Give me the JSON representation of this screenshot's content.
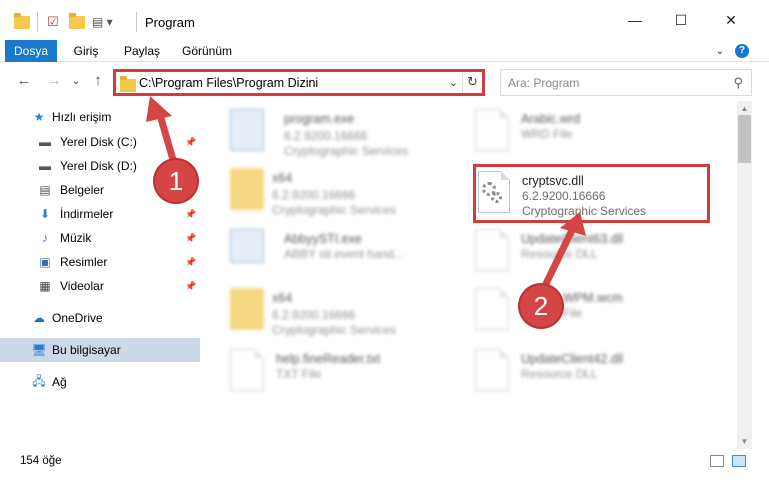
{
  "window": {
    "title": "Program",
    "minimize": "—",
    "maximize": "☐",
    "close": "✕"
  },
  "ribbon": {
    "tabs": [
      "Dosya",
      "Giriş",
      "Paylaş",
      "Görünüm"
    ],
    "help": "?"
  },
  "nav": {
    "back": "←",
    "forward": "→",
    "recent": "⌄",
    "up": "↑",
    "address": "C:\\Program Files\\Program Dizini",
    "search_placeholder": "Ara: Program"
  },
  "sidebar": {
    "items": [
      {
        "label": "Hızlı erişim",
        "icon": "star-icon"
      },
      {
        "label": "Yerel Disk (C:)",
        "icon": "drive-icon"
      },
      {
        "label": "Yerel Disk (D:)",
        "icon": "drive-icon"
      },
      {
        "label": "Belgeler",
        "icon": "documents-icon"
      },
      {
        "label": "İndirmeler",
        "icon": "download-icon"
      },
      {
        "label": "Müzik",
        "icon": "music-icon"
      },
      {
        "label": "Resimler",
        "icon": "pictures-icon"
      },
      {
        "label": "Videolar",
        "icon": "video-icon"
      },
      {
        "label": "OneDrive",
        "icon": "cloud-icon"
      },
      {
        "label": "Bu bilgisayar",
        "icon": "computer-icon"
      },
      {
        "label": "Ağ",
        "icon": "network-icon"
      }
    ]
  },
  "files": [
    {
      "name": "program.exe",
      "line1": "6.2.9200.16666",
      "line2": "Cryptographic Services",
      "icon": "exe"
    },
    {
      "name": "Arabic.wrd",
      "line1": "WRD File",
      "line2": "",
      "icon": "page"
    },
    {
      "name": "x64",
      "line1": "6.2.9200.16666",
      "line2": "Cryptographic Services",
      "icon": "folder"
    },
    {
      "name": "cryptsvc.dll",
      "line1": "6.2.9200.16666",
      "line2": "Cryptographic Services",
      "icon": "dll"
    },
    {
      "name": "AbbyySTI.exe",
      "line1": "ABBY sti event hand...",
      "line2": "",
      "icon": "exe"
    },
    {
      "name": "UpdateClient63.dll",
      "line1": "Resource DLL",
      "line2": "",
      "icon": "dll"
    },
    {
      "name": "x64",
      "line1": "6.2.9200.16666",
      "line2": "Cryptographic Services",
      "icon": "folder"
    },
    {
      "name": "WPM.wcm",
      "line1": "File",
      "line2": "",
      "icon": "page"
    },
    {
      "name": "help.fineReader.txt",
      "line1": "TXT File",
      "line2": "",
      "icon": "page"
    },
    {
      "name": "UpdateClient42.dll",
      "line1": "Resource DLL",
      "line2": "",
      "icon": "dll"
    }
  ],
  "status": {
    "count": "154 öğe"
  },
  "annotations": [
    "1",
    "2"
  ],
  "colors": {
    "accent": "#1979ca",
    "highlight": "#d13c3c",
    "selected": "#ccd9e7"
  }
}
